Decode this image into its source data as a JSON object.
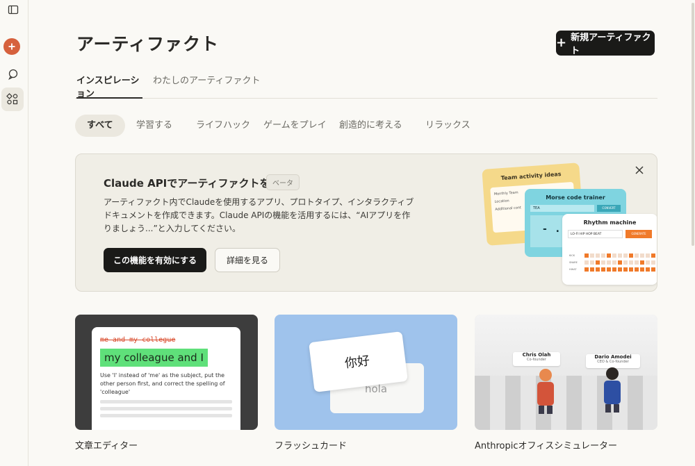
{
  "page": {
    "title": "アーティファクト",
    "new_artifact_label": "新規アーティファクト"
  },
  "tabs": [
    {
      "label": "インスピレーション",
      "active": true
    },
    {
      "label": "わたしのアーティファクト",
      "active": false
    }
  ],
  "filters": [
    {
      "label": "すべて",
      "active": true
    },
    {
      "label": "学習する"
    },
    {
      "label": "ライフハック"
    },
    {
      "label": "ゲームをプレイ"
    },
    {
      "label": "創造的に考える"
    },
    {
      "label": "リラックス"
    }
  ],
  "banner": {
    "title": "Claude APIでアーティファクトを強化",
    "badge": "ベータ",
    "description": "アーティファクト内でClaudeを使用するアプリ、プロトタイプ、インタラクティブドキュメントを作成できます。Claude APIの機能を活用するには、“AIアプリを作りましょう...”と入力してください。",
    "enable_label": "この機能を有効にする",
    "details_label": "詳細を見る",
    "illustration": {
      "team_title": "Team activity ideas",
      "team_lines": [
        "Monthly Team",
        "Location",
        "Additional cont"
      ],
      "morse_title": "Morse code trainer",
      "morse_input": "TEA",
      "morse_button": "CONVERT",
      "morse_output": "- . .-",
      "rhythm_title": "Rhythm machine",
      "rhythm_input": "LO-FI HIP HOP BEAT",
      "rhythm_button": "GENERATE",
      "rhythm_tracks": [
        {
          "name": "KICK",
          "pattern": [
            1,
            0,
            0,
            0,
            1,
            0,
            0,
            0,
            1,
            0,
            0,
            0,
            1,
            0,
            0,
            0
          ]
        },
        {
          "name": "SNARE",
          "pattern": [
            0,
            0,
            1,
            0,
            0,
            0,
            1,
            0,
            0,
            0,
            1,
            0,
            0,
            0,
            1,
            0
          ]
        },
        {
          "name": "HIHAT",
          "pattern": [
            1,
            1,
            1,
            1,
            1,
            1,
            1,
            1,
            1,
            1,
            1,
            1,
            1,
            1,
            1,
            1
          ]
        }
      ]
    }
  },
  "gallery": [
    {
      "label": "文章エディター",
      "preview": {
        "strike": "me and my collegue",
        "highlight": "my colleague and I",
        "note": "Use 'I' instead of 'me' as the subject, put the other person first, and correct the spelling of 'colleague'"
      }
    },
    {
      "label": "フラッシュカード",
      "preview": {
        "front": "你好",
        "back": "hola"
      }
    },
    {
      "label": "Anthropicオフィスシミュレーター",
      "preview": {
        "people": [
          {
            "name": "Chris Olah",
            "role": "Co-founder"
          },
          {
            "name": "Dario Amodei",
            "role": "CEO & Co-founder"
          }
        ]
      }
    }
  ],
  "colors": {
    "accent": "#d6613d",
    "dark_button": "#1a1a18",
    "background": "#faf9f5"
  }
}
